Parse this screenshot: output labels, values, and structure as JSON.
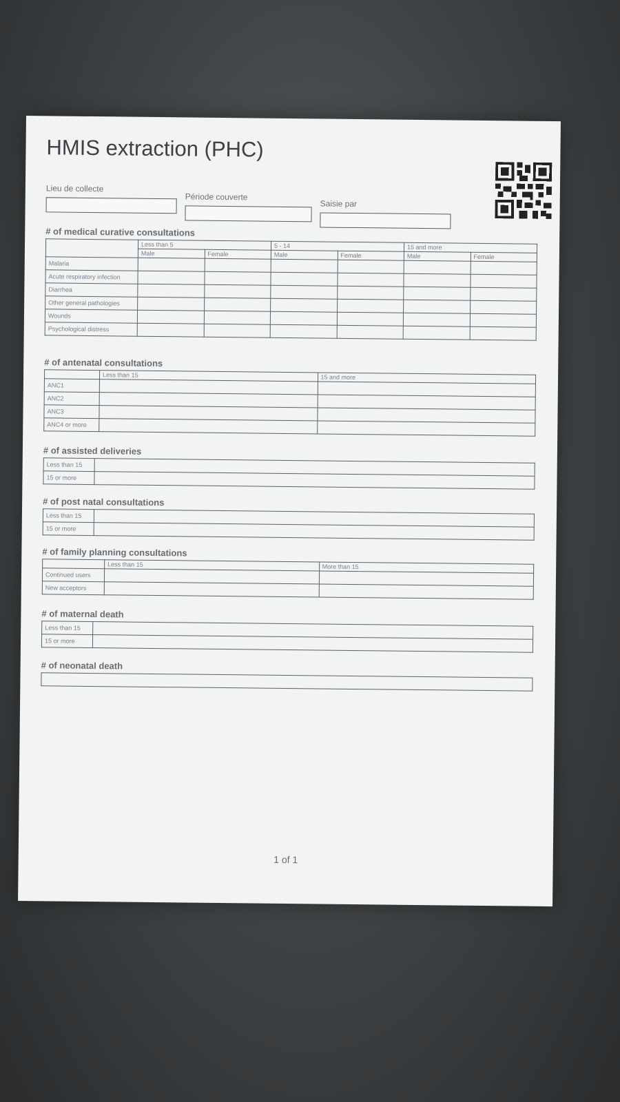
{
  "form": {
    "title": "HMIS extraction (PHC)",
    "fields": {
      "lieu_label": "Lieu de collecte",
      "periode_label": "Période couverte",
      "saisie_label": "Saisie par"
    },
    "qr_icon": "qr-code-icon"
  },
  "curative": {
    "title": "# of medical curative consultations",
    "age_groups": [
      "Less than 5",
      "5 - 14",
      "15 and more"
    ],
    "sexes": [
      "Male",
      "Female"
    ],
    "rows": [
      "Malaria",
      "Acute respiratory infection",
      "Diarrhea",
      "Other general pathologies",
      "Wounds",
      "Psychological distress"
    ]
  },
  "antenatal": {
    "title": "# of antenatal consultations",
    "columns": [
      "Less than 15",
      "15 and more"
    ],
    "rows": [
      "ANC1",
      "ANC2",
      "ANC3",
      "ANC4 or more"
    ]
  },
  "deliveries": {
    "title": "# of assisted deliveries",
    "rows": [
      "Less than 15",
      "15 or more"
    ]
  },
  "postnatal": {
    "title": "# of post natal consultations",
    "rows": [
      "Less than 15",
      "15 or more"
    ]
  },
  "family_planning": {
    "title": "# of family planning consultations",
    "columns": [
      "Less than 15",
      "More than 15"
    ],
    "rows": [
      "Continued users",
      "New acceptors"
    ]
  },
  "maternal_death": {
    "title": "# of maternal death",
    "rows": [
      "Less than 15",
      "15 or more"
    ]
  },
  "neonatal_death": {
    "title": "# of neonatal death"
  },
  "footer": {
    "page_number": "1 of 1"
  },
  "colors": {
    "page_background": "#f2f3f3",
    "grid_line": "#5a5f6c",
    "backdrop": "#3e4143"
  }
}
